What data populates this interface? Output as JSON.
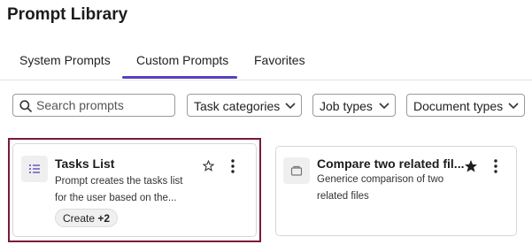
{
  "page": {
    "title": "Prompt Library"
  },
  "tabs": [
    {
      "label": "System Prompts",
      "active": false
    },
    {
      "label": "Custom Prompts",
      "active": true
    },
    {
      "label": "Favorites",
      "active": false
    }
  ],
  "colors": {
    "accent": "#5a3fc0",
    "selected_border": "#7a1a3c"
  },
  "filters": {
    "search": {
      "placeholder": "Search prompts",
      "value": ""
    },
    "task_categories": "Task categories",
    "job_types": "Job types",
    "document_types": "Document types"
  },
  "cards": [
    {
      "title": "Tasks List",
      "description_line1": "Prompt creates the tasks list",
      "description_line2": "for the user based on the...",
      "tag": "Create",
      "tag_extra": "+2",
      "favorite": false,
      "icon": "list-icon"
    },
    {
      "title": "Compare two related fil...",
      "description_line1": "Generice comparison of two",
      "description_line2": "related files",
      "favorite": true,
      "icon": "folder-icon"
    }
  ]
}
